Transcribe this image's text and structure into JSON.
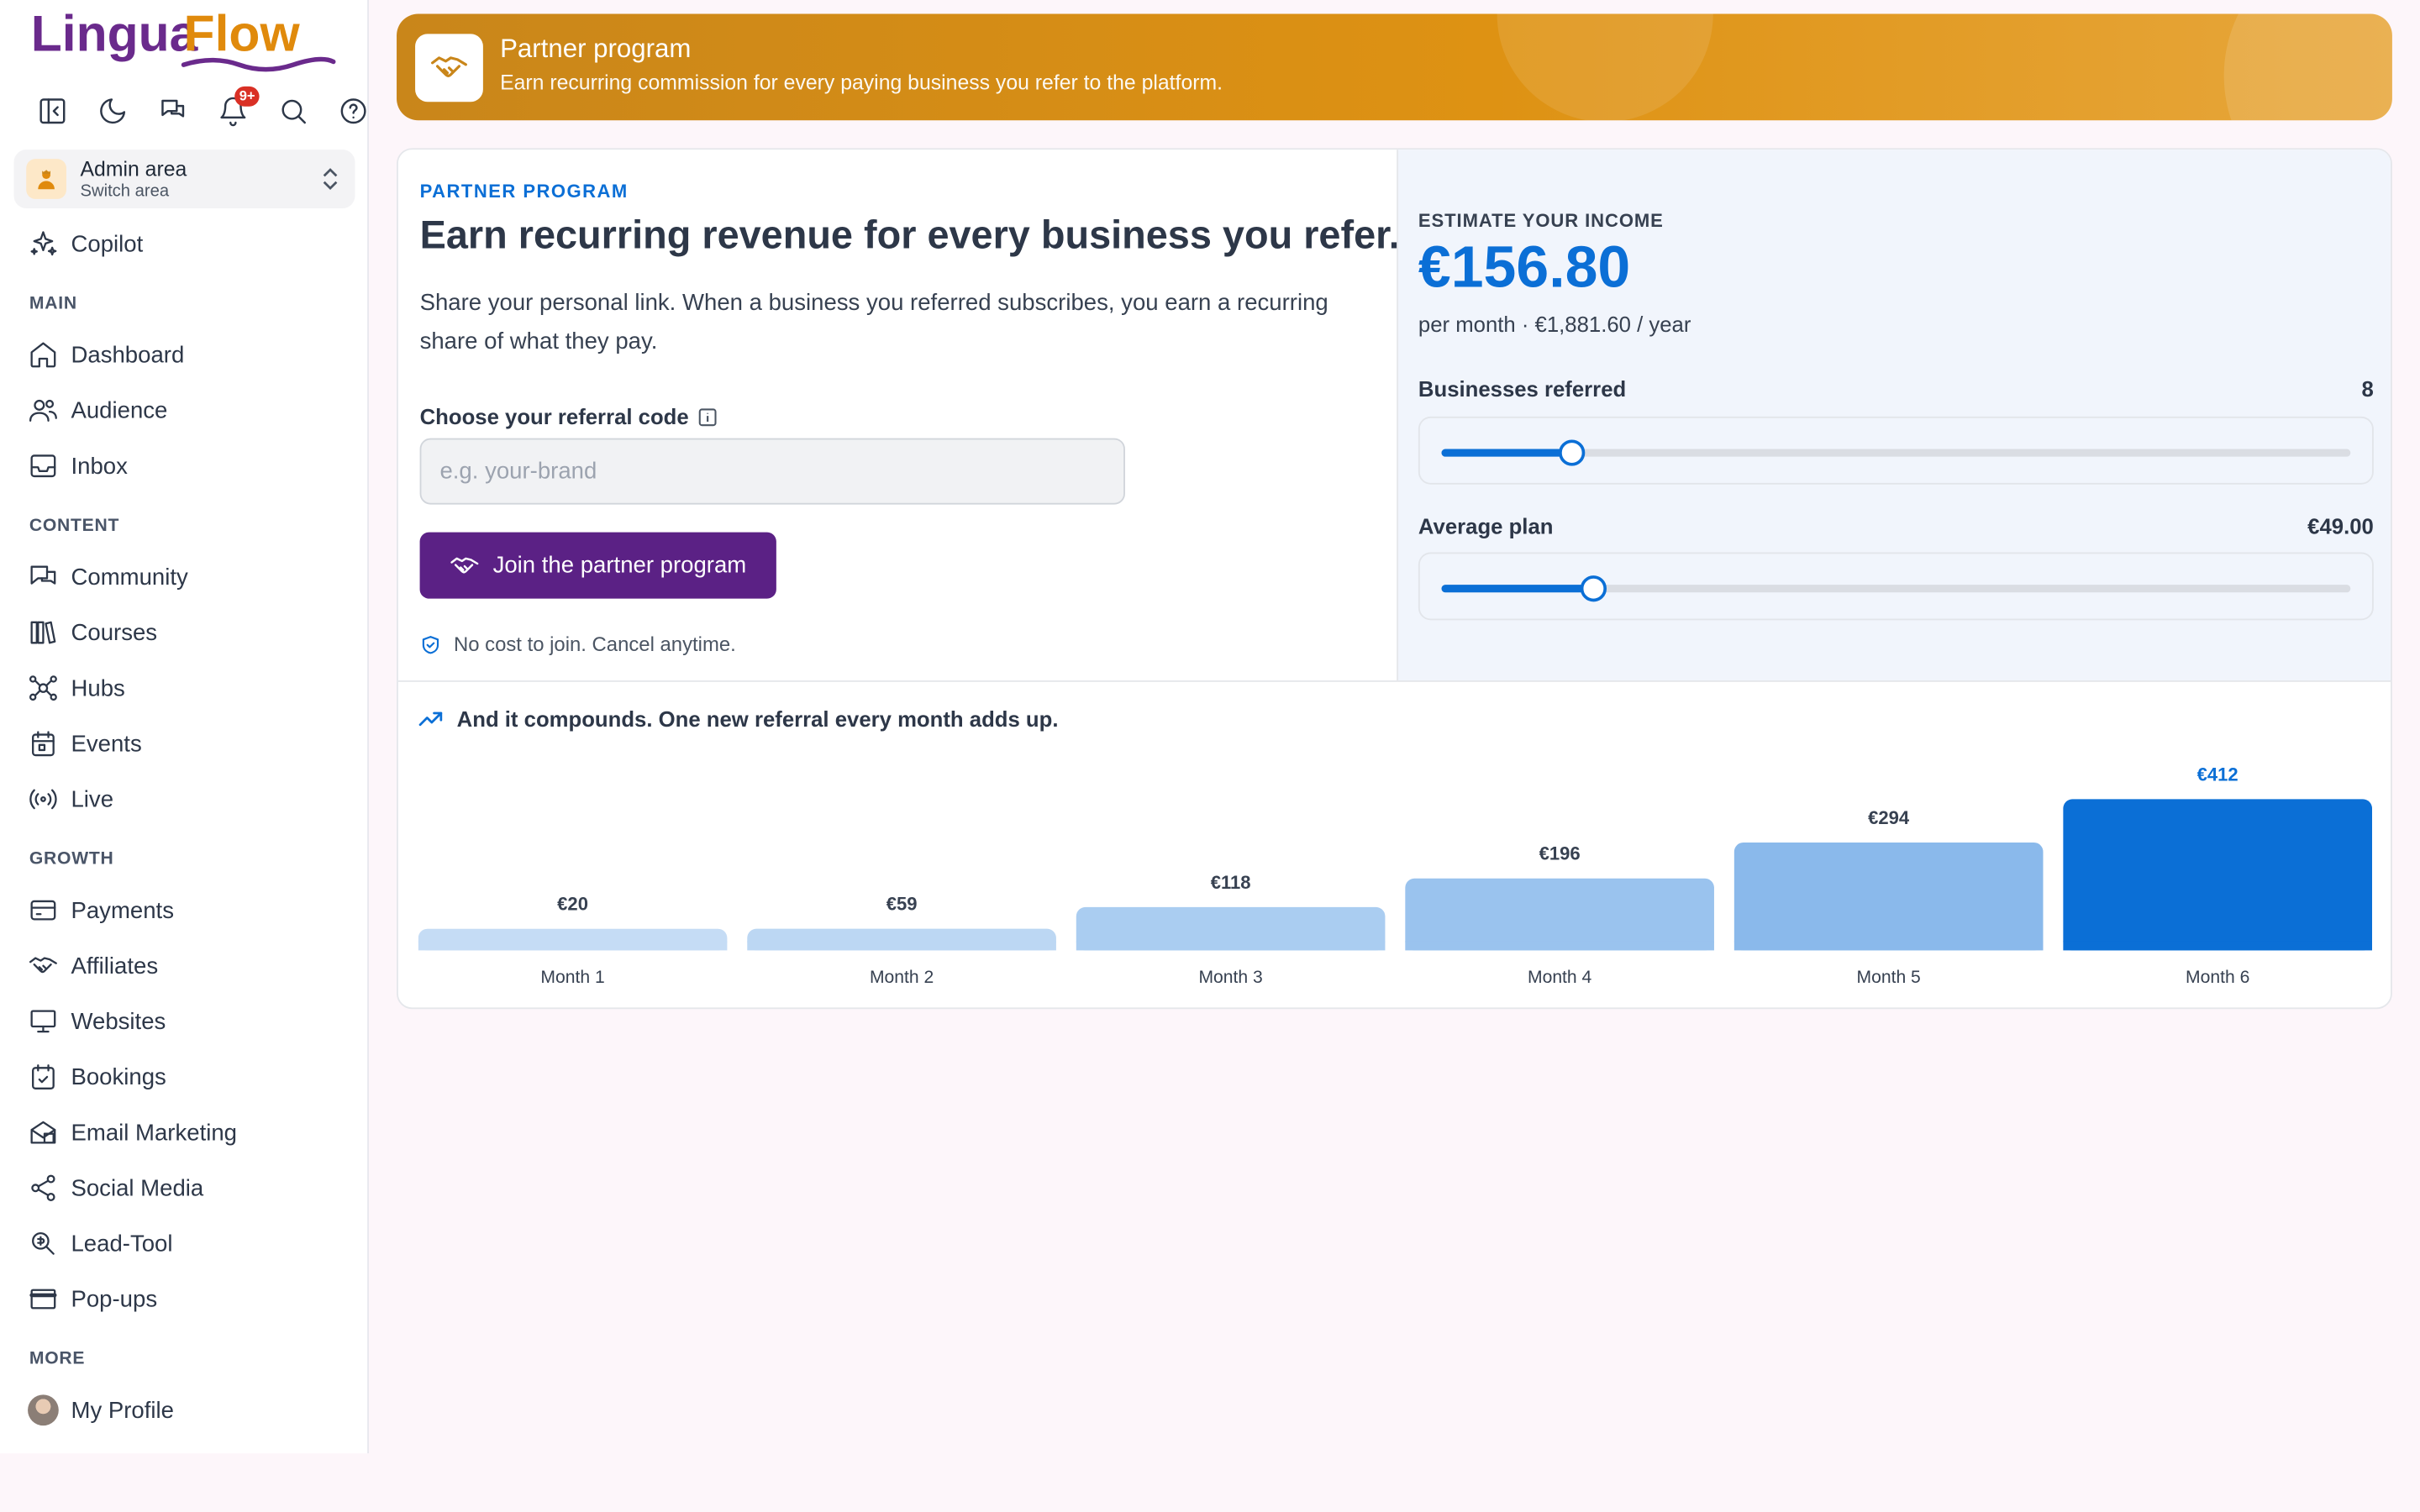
{
  "app": {
    "logo_part1": "Lingua",
    "logo_part2": "Flow"
  },
  "toolbar": {
    "notifications_badge": "9+"
  },
  "area": {
    "title": "Admin area",
    "subtitle": "Switch area"
  },
  "sidebar": {
    "copilot": "Copilot",
    "sections": [
      {
        "title": "MAIN",
        "items": [
          "Dashboard",
          "Audience",
          "Inbox"
        ]
      },
      {
        "title": "CONTENT",
        "items": [
          "Community",
          "Courses",
          "Hubs",
          "Events",
          "Live"
        ]
      },
      {
        "title": "GROWTH",
        "items": [
          "Payments",
          "Affiliates",
          "Websites",
          "Bookings",
          "Email Marketing",
          "Social Media",
          "Lead-Tool",
          "Pop-ups"
        ]
      },
      {
        "title": "MORE",
        "items": [
          "My Profile"
        ]
      }
    ]
  },
  "banner": {
    "title": "Partner program",
    "subtitle": "Earn recurring commission for every paying business you refer to the platform."
  },
  "main": {
    "eyebrow": "PARTNER PROGRAM",
    "headline": "Earn recurring revenue for every business you refer.",
    "description": "Share your personal link. When a business you referred subscribes, you earn a recurring share of what they pay.",
    "code_label": "Choose your referral code",
    "code_placeholder": "e.g. your-brand",
    "join_button": "Join the partner program",
    "no_cost": "No cost to join. Cancel anytime."
  },
  "estimate": {
    "label": "ESTIMATE YOUR INCOME",
    "value": "€156.80",
    "sub": "per month · €1,881.60 / year",
    "businesses_label": "Businesses referred",
    "businesses_value": "8",
    "businesses_fraction": 0.142,
    "plan_label": "Average plan",
    "plan_value": "€49.00",
    "plan_fraction": 0.166
  },
  "compound": {
    "title": "And it compounds. One new referral every month adds up."
  },
  "chart_data": {
    "type": "bar",
    "categories": [
      "Month 1",
      "Month 2",
      "Month 3",
      "Month 4",
      "Month 5",
      "Month 6"
    ],
    "values": [
      20,
      59,
      118,
      196,
      294,
      412
    ],
    "labels": [
      "€20",
      "€59",
      "€118",
      "€196",
      "€294",
      "€412"
    ],
    "colors": [
      "#c5dcf5",
      "#bcd7f3",
      "#aacdf1",
      "#9ac3ee",
      "#8ab9eb",
      "#0b6fd6"
    ],
    "highlight_index": 5
  }
}
